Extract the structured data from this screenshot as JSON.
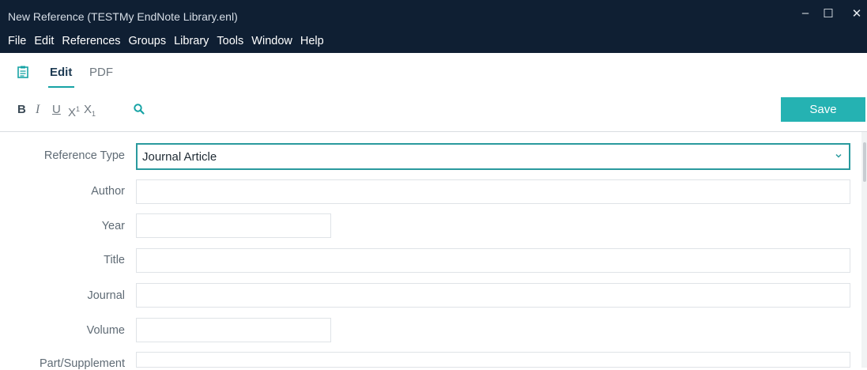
{
  "window": {
    "title": "New Reference (TESTMy EndNote Library.enl)",
    "controls": {
      "minimize": "–",
      "maximize": "☐",
      "close": "✕"
    }
  },
  "menu": [
    "File",
    "Edit",
    "References",
    "Groups",
    "Library",
    "Tools",
    "Window",
    "Help"
  ],
  "tabs": {
    "edit": "Edit",
    "pdf": "PDF"
  },
  "toolbar": {
    "bold": "B",
    "italic": "I",
    "underline": "U",
    "superscript": "X",
    "superscript_mark": "1",
    "subscript": "X",
    "subscript_mark": "1",
    "save_label": "Save"
  },
  "form": {
    "reference_type_label": "Reference Type",
    "reference_type_value": "Journal Article",
    "fields": {
      "author": {
        "label": "Author",
        "value": ""
      },
      "year": {
        "label": "Year",
        "value": ""
      },
      "title": {
        "label": "Title",
        "value": ""
      },
      "journal": {
        "label": "Journal",
        "value": ""
      },
      "volume": {
        "label": "Volume",
        "value": ""
      },
      "part_supplement": {
        "label": "Part/Supplement",
        "value": ""
      }
    }
  },
  "colors": {
    "titlebar": "#0f1f33",
    "accent": "#25b2b2",
    "select_border": "#2a9a9e"
  }
}
